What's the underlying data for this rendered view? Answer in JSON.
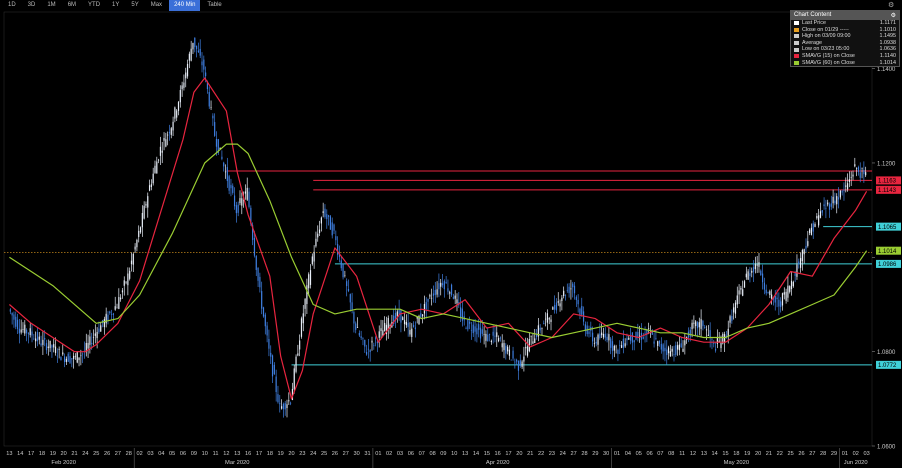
{
  "toolbar": {
    "buttons": [
      "1D",
      "3D",
      "1M",
      "6M",
      "YTD",
      "1Y",
      "5Y",
      "Max",
      "240 Min",
      "Table"
    ],
    "active_index": 8
  },
  "legend": {
    "header": "Chart Content",
    "rows": [
      {
        "label": "Last Price",
        "value": "1.1171",
        "color": "#ffffff"
      },
      {
        "label": "Close on 01/29 -----",
        "value": "1.1010",
        "color": "#e8a020"
      },
      {
        "label": "High on 03/09 09:00",
        "value": "1.1495",
        "color": "#cccccc"
      },
      {
        "label": "Average",
        "value": "1.0938",
        "color": "#cccccc"
      },
      {
        "label": "Low on 03/23 05:00",
        "value": "1.0636",
        "color": "#cccccc"
      },
      {
        "label": "SMAVG (15) on Close",
        "value": "1.1140",
        "color": "#e8253f"
      },
      {
        "label": "SMAVG (60) on Close",
        "value": "1.1014",
        "color": "#9acd32"
      }
    ]
  },
  "chart_data": {
    "type": "line",
    "title": "",
    "xlabel": "",
    "ylabel": "",
    "ylim": [
      1.06,
      1.152
    ],
    "y_ticks": [
      1.06,
      1.08,
      1.1,
      1.12,
      1.14
    ],
    "y_tick_labels": [
      "1.0600",
      "1.0800",
      "",
      "1.1200",
      "1.1400"
    ],
    "x_day_labels": [
      "13",
      "14",
      "17",
      "18",
      "19",
      "20",
      "21",
      "24",
      "25",
      "26",
      "27",
      "28",
      "02",
      "03",
      "04",
      "05",
      "06",
      "09",
      "10",
      "11",
      "12",
      "13",
      "16",
      "17",
      "18",
      "19",
      "20",
      "23",
      "24",
      "25",
      "26",
      "27",
      "30",
      "31",
      "01",
      "02",
      "03",
      "06",
      "07",
      "08",
      "09",
      "10",
      "13",
      "14",
      "15",
      "16",
      "17",
      "20",
      "21",
      "22",
      "23",
      "24",
      "27",
      "28",
      "29",
      "30",
      "01",
      "04",
      "05",
      "06",
      "07",
      "08",
      "11",
      "12",
      "13",
      "14",
      "15",
      "18",
      "19",
      "20",
      "21",
      "22",
      "25",
      "26",
      "27",
      "28",
      "29",
      "01",
      "02",
      "03"
    ],
    "month_labels": [
      {
        "label": "Feb 2020",
        "index": 5
      },
      {
        "label": "Mar 2020",
        "index": 21
      },
      {
        "label": "Apr 2020",
        "index": 45
      },
      {
        "label": "May 2020",
        "index": 67
      },
      {
        "label": "Jun 2020",
        "index": 78
      }
    ],
    "price_x": [
      0,
      1,
      2,
      3,
      4,
      5,
      6,
      7,
      8,
      9,
      10,
      11,
      12,
      13,
      14,
      15,
      16,
      17,
      18,
      19,
      20,
      21,
      22,
      23,
      24,
      25,
      26,
      27,
      28,
      29,
      30,
      31,
      32,
      33,
      34,
      35,
      36,
      37,
      38,
      39,
      40,
      41,
      42,
      43,
      44,
      45,
      46,
      47,
      48,
      49,
      50,
      51,
      52,
      53,
      54,
      55,
      56,
      57,
      58,
      59,
      60,
      61,
      62,
      63,
      64,
      65,
      66,
      67,
      68,
      69,
      70,
      71,
      72,
      73,
      74,
      75,
      76,
      77,
      78,
      79
    ],
    "price": [
      1.089,
      1.085,
      1.084,
      1.082,
      1.081,
      1.079,
      1.0785,
      1.08,
      1.084,
      1.087,
      1.09,
      1.096,
      1.105,
      1.115,
      1.123,
      1.128,
      1.136,
      1.146,
      1.14,
      1.126,
      1.118,
      1.11,
      1.114,
      1.095,
      1.08,
      1.068,
      1.07,
      1.086,
      1.1,
      1.11,
      1.105,
      1.095,
      1.085,
      1.08,
      1.083,
      1.086,
      1.088,
      1.084,
      1.088,
      1.092,
      1.095,
      1.092,
      1.086,
      1.085,
      1.083,
      1.083,
      1.08,
      1.077,
      1.082,
      1.085,
      1.088,
      1.092,
      1.094,
      1.086,
      1.082,
      1.084,
      1.08,
      1.083,
      1.083,
      1.084,
      1.081,
      1.08,
      1.081,
      1.085,
      1.086,
      1.081,
      1.083,
      1.09,
      1.096,
      1.099,
      1.092,
      1.09,
      1.094,
      1.1,
      1.106,
      1.11,
      1.112,
      1.114,
      1.119,
      1.1171
    ],
    "series": [
      {
        "name": "SMAVG (15)",
        "color": "#e8253f",
        "x": [
          0,
          2,
          4,
          6,
          7,
          8,
          10,
          12,
          14,
          16,
          17,
          18,
          20,
          21,
          22,
          24,
          25,
          26,
          27,
          28,
          30,
          32,
          34,
          36,
          38,
          40,
          42,
          44,
          46,
          48,
          50,
          52,
          54,
          56,
          58,
          60,
          62,
          64,
          66,
          68,
          70,
          72,
          74,
          76,
          78,
          79
        ],
        "values": [
          1.09,
          1.086,
          1.083,
          1.08,
          1.08,
          1.0815,
          1.086,
          1.095,
          1.11,
          1.125,
          1.135,
          1.138,
          1.131,
          1.118,
          1.109,
          1.096,
          1.079,
          1.07,
          1.076,
          1.088,
          1.102,
          1.096,
          1.082,
          1.088,
          1.089,
          1.088,
          1.091,
          1.085,
          1.086,
          1.081,
          1.083,
          1.088,
          1.087,
          1.084,
          1.083,
          1.085,
          1.083,
          1.082,
          1.082,
          1.085,
          1.09,
          1.097,
          1.096,
          1.104,
          1.11,
          1.114
        ]
      },
      {
        "name": "SMAVG (60)",
        "color": "#9acd32",
        "x": [
          0,
          4,
          8,
          10,
          12,
          15,
          18,
          20,
          21,
          22,
          24,
          26,
          28,
          30,
          32,
          34,
          36,
          38,
          40,
          42,
          44,
          46,
          48,
          50,
          52,
          54,
          56,
          58,
          60,
          62,
          64,
          66,
          68,
          70,
          72,
          74,
          76,
          78,
          79
        ],
        "values": [
          1.1,
          1.094,
          1.086,
          1.087,
          1.092,
          1.105,
          1.12,
          1.124,
          1.124,
          1.122,
          1.112,
          1.1,
          1.09,
          1.088,
          1.089,
          1.089,
          1.089,
          1.087,
          1.088,
          1.087,
          1.086,
          1.085,
          1.084,
          1.083,
          1.084,
          1.085,
          1.086,
          1.085,
          1.084,
          1.084,
          1.083,
          1.083,
          1.085,
          1.086,
          1.088,
          1.09,
          1.092,
          1.098,
          1.1014
        ]
      }
    ],
    "hlines": [
      {
        "value": 1.1183,
        "x_start": 20.5,
        "color": "#e8253f",
        "label": "",
        "label_bg": ""
      },
      {
        "value": 1.1163,
        "x_start": 28.5,
        "color": "#e8253f",
        "label": "1.1163",
        "label_bg": "#e8253f"
      },
      {
        "value": 1.1143,
        "x_start": 28.5,
        "color": "#e8253f",
        "label": "1.1143",
        "label_bg": "#e8253f"
      },
      {
        "value": 1.1065,
        "x_start": 75.5,
        "color": "#40d0d8",
        "label": "1.1065",
        "label_bg": "#40d0d8"
      },
      {
        "value": 1.0986,
        "x_start": 30.5,
        "color": "#40d0d8",
        "label": "1.0986",
        "label_bg": "#40d0d8"
      },
      {
        "value": 1.0772,
        "x_start": 26.5,
        "color": "#40d0d8",
        "label": "1.0772",
        "label_bg": "#40d0d8"
      }
    ],
    "reference_line": {
      "value": 1.101,
      "color": "#e8a020",
      "label": ""
    },
    "last_labels": [
      {
        "value": 1.1014,
        "label": "1.1014",
        "bg": "#9acd32"
      }
    ]
  }
}
